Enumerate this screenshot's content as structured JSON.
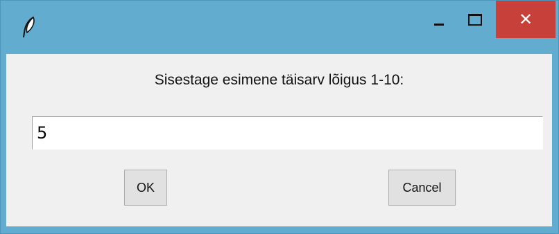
{
  "window": {
    "title": "",
    "icon": "feather-icon",
    "controls": {
      "minimize_icon": "minimize-icon",
      "maximize_icon": "maximize-icon",
      "close_label": "✕"
    },
    "colors": {
      "frame": "#62acd0",
      "close_button": "#c7403a",
      "client": "#f0f0f0"
    }
  },
  "dialog": {
    "prompt": "Sisestage esimene täisarv lõigus 1-10:",
    "input_value": "5",
    "ok_label": "OK",
    "cancel_label": "Cancel"
  }
}
